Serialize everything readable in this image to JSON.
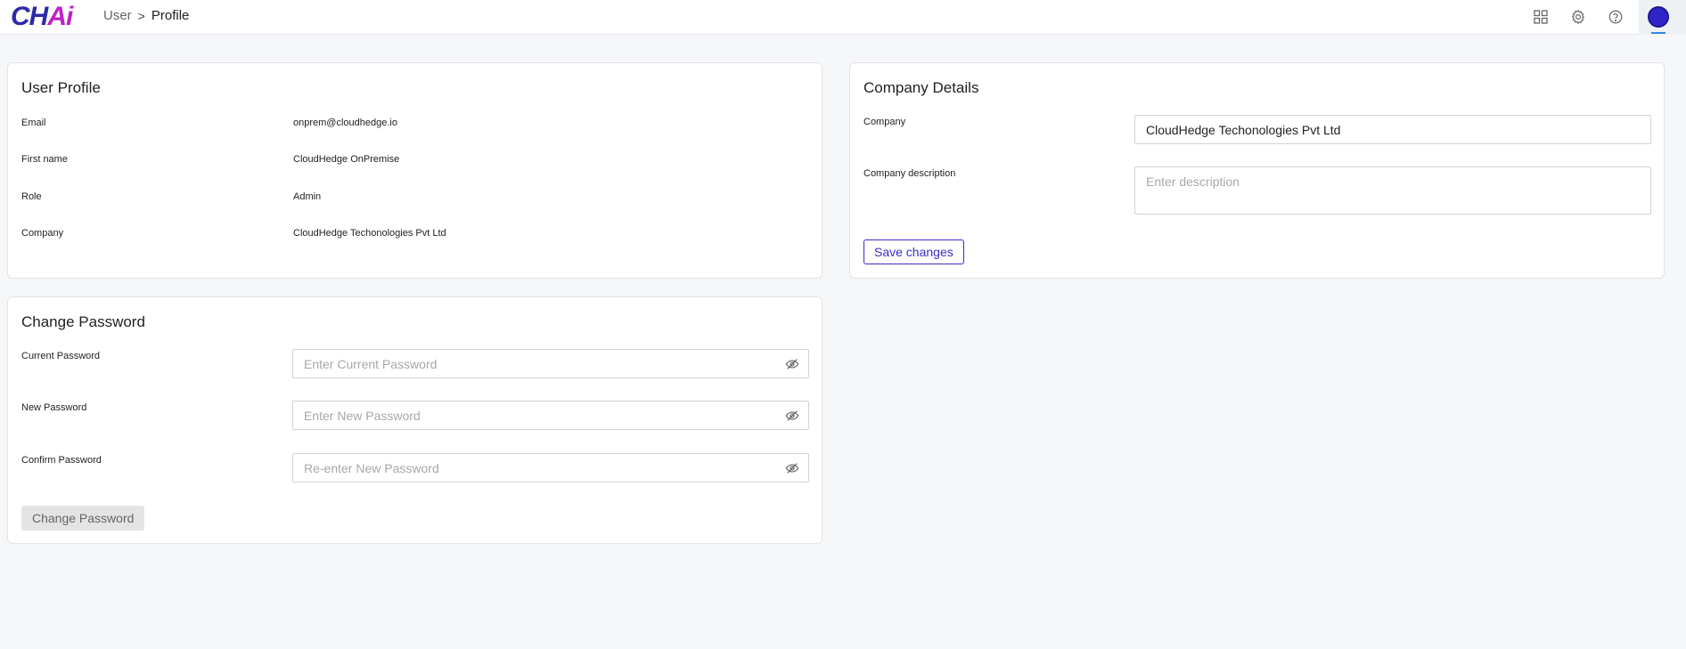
{
  "header": {
    "logo_part1": "CH",
    "logo_part2": "Ai",
    "breadcrumb": {
      "parent": "User",
      "separator": ">",
      "current": "Profile"
    },
    "icons": [
      "grid-icon",
      "gear-icon",
      "help-icon",
      "avatar"
    ]
  },
  "user_profile": {
    "title": "User Profile",
    "fields": [
      {
        "label": "Email",
        "value": "onprem@cloudhedge.io"
      },
      {
        "label": "First name",
        "value": "CloudHedge OnPremise"
      },
      {
        "label": "Role",
        "value": "Admin"
      },
      {
        "label": "Company",
        "value": "CloudHedge Techonologies Pvt Ltd"
      }
    ]
  },
  "change_password": {
    "title": "Change Password",
    "current_label": "Current Password",
    "current_placeholder": "Enter Current Password",
    "new_label": "New Password",
    "new_placeholder": "Enter New Password",
    "confirm_label": "Confirm Password",
    "confirm_placeholder": "Re-enter New Password",
    "button_label": "Change Password"
  },
  "company_details": {
    "title": "Company Details",
    "company_label": "Company",
    "company_value": "CloudHedge Techonologies Pvt Ltd",
    "description_label": "Company description",
    "description_placeholder": "Enter description",
    "save_label": "Save changes"
  },
  "colors": {
    "accent": "#3a2cc8",
    "logo_blue": "#2c2aa8",
    "logo_pink": "#c020c8",
    "background": "#f6f7f9"
  }
}
